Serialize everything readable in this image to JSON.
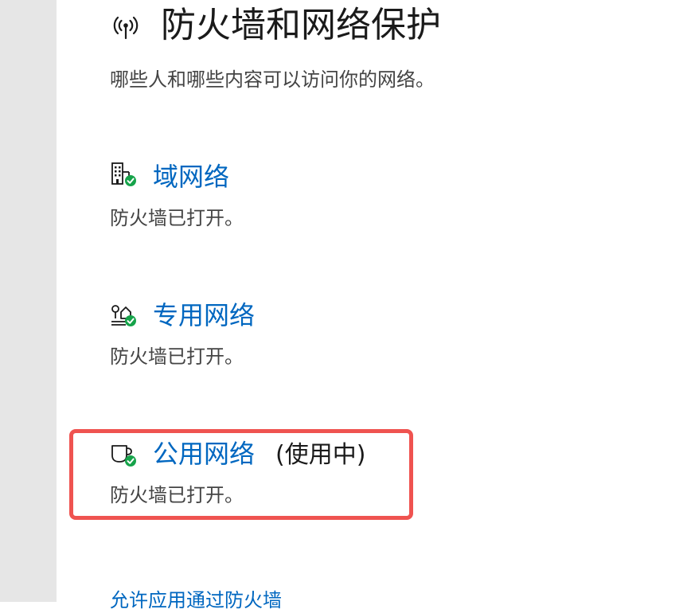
{
  "header": {
    "icon": "wifi-antenna-icon",
    "title": "防火墙和网络保护",
    "subtitle": "哪些人和哪些内容可以访问你的网络。"
  },
  "networks": [
    {
      "name": "域网络",
      "icon": "building-shield-icon",
      "status": "防火墙已打开。"
    },
    {
      "name": "专用网络",
      "icon": "home-network-icon",
      "status": "防火墙已打开。"
    },
    {
      "name": "公用网络",
      "icon": "coffee-cup-icon",
      "in_use": "(使用中)",
      "status": "防火墙已打开。"
    }
  ],
  "bottom_link": "允许应用通过防火墙",
  "colors": {
    "link": "#0067c0",
    "check": "#16a34a",
    "highlight": "#ef5350"
  }
}
